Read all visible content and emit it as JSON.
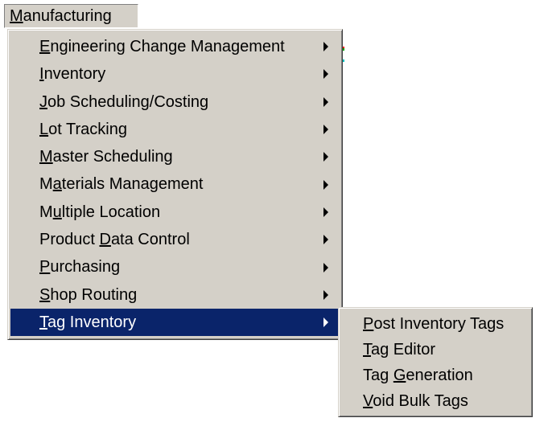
{
  "menubar": {
    "title_ul": "M",
    "title_rest": "anufacturing"
  },
  "menu": {
    "items": [
      {
        "pre": "",
        "ul": "E",
        "post": "ngineering Change Management",
        "has_submenu": true
      },
      {
        "pre": "",
        "ul": "I",
        "post": "nventory",
        "has_submenu": true
      },
      {
        "pre": "",
        "ul": "J",
        "post": "ob Scheduling/Costing",
        "has_submenu": true
      },
      {
        "pre": "",
        "ul": "L",
        "post": "ot Tracking",
        "has_submenu": true
      },
      {
        "pre": "",
        "ul": "M",
        "post": "aster Scheduling",
        "has_submenu": true
      },
      {
        "pre": "M",
        "ul": "a",
        "post": "terials Management",
        "has_submenu": true
      },
      {
        "pre": "M",
        "ul": "u",
        "post": "ltiple Location",
        "has_submenu": true
      },
      {
        "pre": "Product ",
        "ul": "D",
        "post": "ata Control",
        "has_submenu": true
      },
      {
        "pre": "",
        "ul": "P",
        "post": "urchasing",
        "has_submenu": true
      },
      {
        "pre": "",
        "ul": "S",
        "post": "hop Routing",
        "has_submenu": true
      },
      {
        "pre": "",
        "ul": "T",
        "post": "ag Inventory",
        "has_submenu": true,
        "highlighted": true
      }
    ]
  },
  "submenu": {
    "items": [
      {
        "pre": "",
        "ul": "P",
        "post": "ost Inventory Tags"
      },
      {
        "pre": "",
        "ul": "T",
        "post": "ag Editor"
      },
      {
        "pre": "Tag ",
        "ul": "G",
        "post": "eneration"
      },
      {
        "pre": "",
        "ul": "V",
        "post": "oid Bulk Tags"
      }
    ]
  },
  "colors": {
    "menu_background": "#d4d0c8",
    "highlight_background": "#0a246a",
    "highlight_text": "#ffffff"
  },
  "icons": {
    "submenu_arrow": "right-triangle"
  }
}
